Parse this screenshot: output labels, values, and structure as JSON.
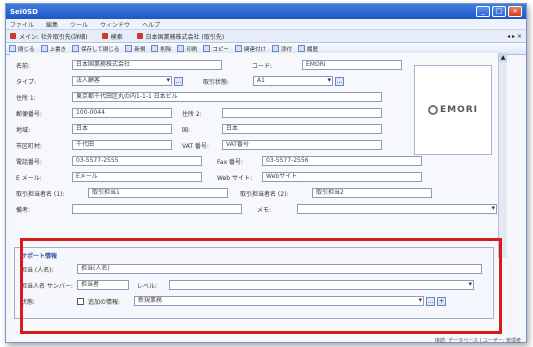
{
  "window": {
    "title": "Sei0SD",
    "minimize": "_",
    "maximize": "□",
    "close": "×"
  },
  "menu": [
    "ファイル",
    "編集",
    "ツール",
    "ウィンドウ",
    "ヘルプ"
  ],
  "tabs": [
    {
      "label": "メイン: 社外取引先(詳細)"
    },
    {
      "label": "検索"
    },
    {
      "label": "日本国業務株式会社 (取引先)"
    }
  ],
  "tab_nav": "◂ ▸ ×",
  "toolbar": [
    "閉じる",
    "上書き",
    "保存して閉じる",
    "新規",
    "削除",
    "印刷",
    "コピー",
    "関連付け",
    "添付",
    "履歴"
  ],
  "form": {
    "name_label": "名前:",
    "name_value": "日本国業務株式会社",
    "code_label": "コード:",
    "code_value": "EMORI",
    "type_label": "タイプ:",
    "type_value": "法人顧客",
    "rank_label": "取引状態:",
    "rank_value": "A1",
    "address_label": "住所 1:",
    "address_value": "東京都千代田区丸の内1-1-1 日本ビル",
    "postal_label": "郵便番号:",
    "postal_value": "100-0044",
    "address2_label": "住所 2:",
    "address2_value": "",
    "region_label": "地域:",
    "region_value": "日本",
    "country_label": "国:",
    "country_value": "日本",
    "city_label": "市区町村:",
    "city_value": "千代田",
    "vat_label": "VAT 番号:",
    "vat_value": "VAT番号",
    "phone_label": "電話番号:",
    "phone_value": "03-5577-2555",
    "fax_label": "Fax 番号:",
    "fax_value": "03-5577-2556",
    "email_label": "E メール:",
    "email_value": "Eメール",
    "web_label": "Web サイト:",
    "web_value": "Webサイト",
    "extra1_label": "取引担当者名 (1):",
    "extra1_value": "取引担当1",
    "extra2_label": "取引担当者名 (2):",
    "extra2_value": "取引担当2",
    "memo_label": "備考:",
    "memo_value": "",
    "memo2_label": "メモ:",
    "memo2_value": ""
  },
  "logo": {
    "text": "EMORI"
  },
  "group": {
    "heading": "サポート情報",
    "person_label": "担当 (人名):",
    "person_value": "担当(人名)",
    "support_label": "担当人名 サンバー:",
    "support_value": "担当者",
    "level_label": "レベル:",
    "level_value": "",
    "status_label": "状態:",
    "status_check_label": "追加の情報:",
    "status_value": "新規業務"
  },
  "statusbar": "接続: データベース  |  ユーザー: 管理者"
}
